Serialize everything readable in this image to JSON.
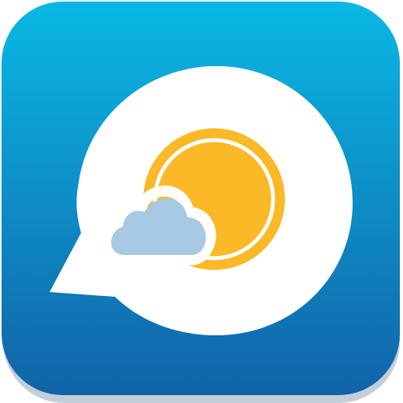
{
  "icon": {
    "name": "weather-app-icon",
    "glyph": "sun-behind-cloud-in-speech-bubble",
    "colors": {
      "tile_top": "#0AB8E4",
      "tile_bottom": "#1163A8",
      "shadow": "#0A3C66",
      "bubble": "#FFFFFF",
      "sun": "#FBB827",
      "sun_inner_ring": "#FFFFFF",
      "cloud": "#A7C9E3",
      "cloud_outline": "#FFFFFF"
    }
  }
}
